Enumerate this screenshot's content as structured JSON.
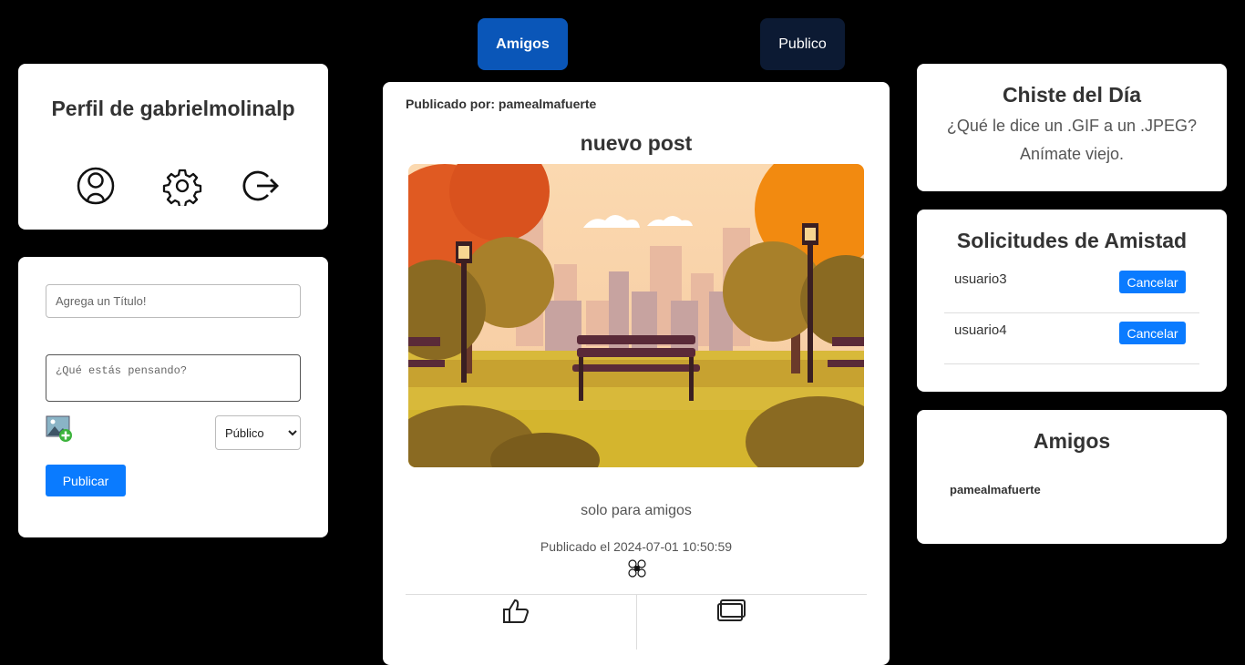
{
  "nav": {
    "amigos_label": "Amigos",
    "publico_label": "Publico"
  },
  "profile": {
    "title": "Perfil de gabrielmolinalp",
    "icons": [
      "user-icon",
      "gear-icon",
      "logout-icon"
    ]
  },
  "compose": {
    "title_placeholder": "Agrega un Título!",
    "body_placeholder": "¿Qué estás pensando?",
    "visibility_selected": "Público",
    "publish_label": "Publicar"
  },
  "post": {
    "author_label": "Publicado por: pamealmafuerte",
    "title": "nuevo post",
    "text": "solo para amigos",
    "date_label": "Publicado el 2024-07-01 10:50:59",
    "image_icon": "autumn-park-illustration"
  },
  "joke": {
    "title": "Chiste del Día",
    "line1": "¿Qué le dice un .GIF a un .JPEG?",
    "line2": "Anímate viejo."
  },
  "requests": {
    "title": "Solicitudes de Amistad",
    "items": [
      {
        "user": "usuario3",
        "action": "Cancelar"
      },
      {
        "user": "usuario4",
        "action": "Cancelar"
      }
    ]
  },
  "friends": {
    "title": "Amigos",
    "items": [
      "pamealmafuerte"
    ]
  },
  "colors": {
    "primary": "#0a7bff",
    "amigos_btn": "#0a56b8",
    "publico_btn": "#0c1a33"
  }
}
